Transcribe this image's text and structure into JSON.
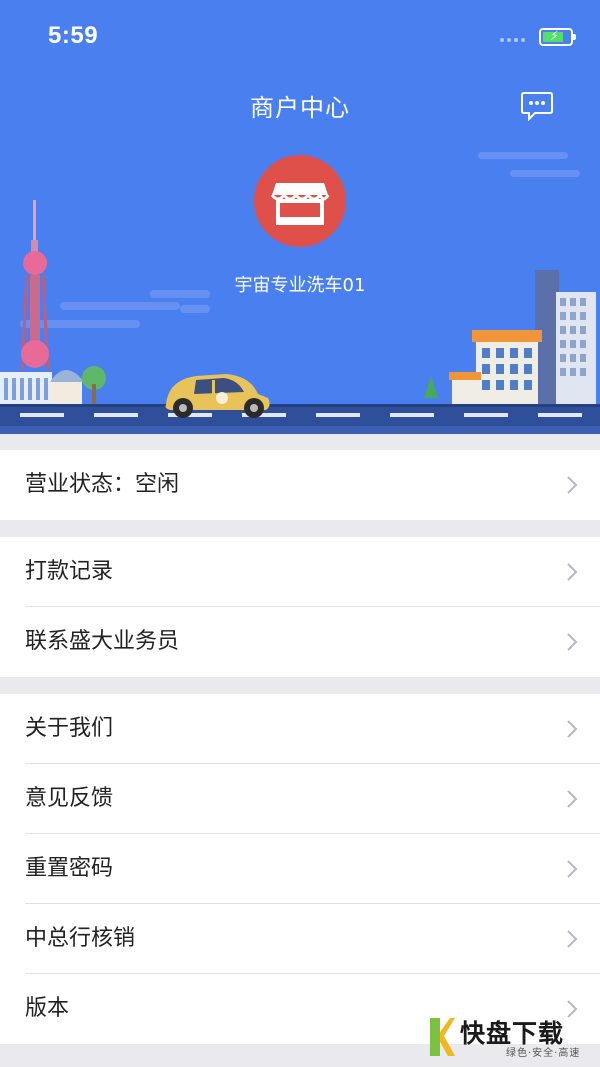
{
  "status_bar": {
    "time": "5:59",
    "battery_level": 0.75,
    "battery_icon": "charging-battery-icon"
  },
  "header": {
    "title": "商户中心",
    "message_icon": "chat-bubble-icon",
    "avatar_icon": "storefront-icon",
    "store_name": "宇宙专业洗车01",
    "background_color": "#4a7ff0",
    "avatar_color": "#e0504a"
  },
  "menu_groups": [
    [
      {
        "label": "营业状态：空闲"
      }
    ],
    [
      {
        "label": "打款记录"
      },
      {
        "label": "联系盛大业务员"
      }
    ],
    [
      {
        "label": "关于我们"
      },
      {
        "label": "意见反馈"
      },
      {
        "label": "重置密码"
      },
      {
        "label": "中总行核销"
      },
      {
        "label": "版本"
      }
    ]
  ],
  "watermark": {
    "brand": "快盘下载",
    "slogan": "绿色·安全·高速"
  }
}
